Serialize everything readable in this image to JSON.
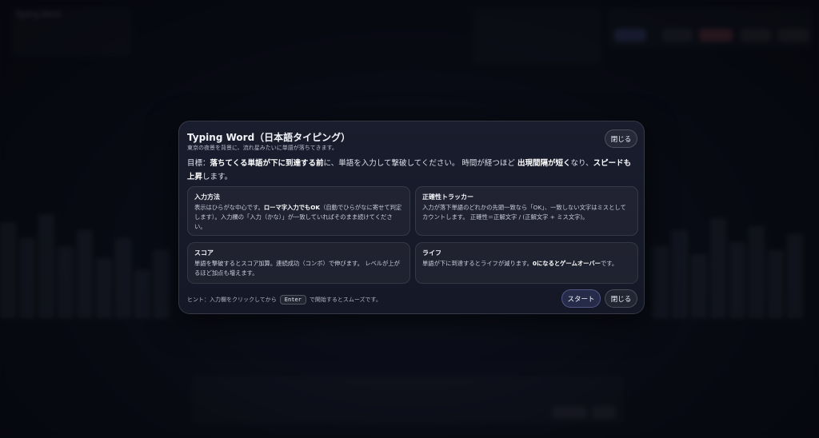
{
  "modal": {
    "title": "Typing Word（日本語タイピング）",
    "subtitle": "東京の夜景を背景に、流れ星みたいに単語が落ちてきます。",
    "close_top_label": "閉じる",
    "goal": {
      "p1": "目標：",
      "p2": "落ちてくる単語が下に到達する前",
      "p3": "に、単語を入力して撃破してください。 時間が経つほど ",
      "p4": "出現間隔が短く",
      "p5": "なり、",
      "p6": "スピードも上昇",
      "p7": "します。"
    },
    "cards": [
      {
        "title": "入力方法",
        "b1": "表示はひらがな中心です。",
        "b2": "ローマ字入力でもOK",
        "b3": "（自動でひらがなに寄せて判定します）。入力欄の「入力（かな）」が一致していればそのまま続けてください。"
      },
      {
        "title": "正確性トラッカー",
        "b1": "入力が落下単語のどれかの先頭一致なら「OK」、一致しない文字はミスとしてカウントします。 正確性＝正解文字 / (正解文字 + ミス文字)。"
      },
      {
        "title": "スコア",
        "b1": "単語を撃破するとスコア加算。連続成功（コンボ）で伸びます。 レベルが上がるほど加点も増えます。"
      },
      {
        "title": "ライフ",
        "b1": "単語が下に到達するとライフが減ります。",
        "b2": "0になるとゲームオーバー",
        "b3": "です。"
      }
    ],
    "hint": {
      "before": "ヒント：入力欄をクリックしてから",
      "key": "Enter",
      "after": "で開始するとスムーズです。"
    },
    "start_label": "スタート",
    "close_bottom_label": "閉じる"
  },
  "background": {
    "title": "Typing Word",
    "colors": {
      "accent": "#7a8cff",
      "danger": "#d0566a"
    }
  }
}
